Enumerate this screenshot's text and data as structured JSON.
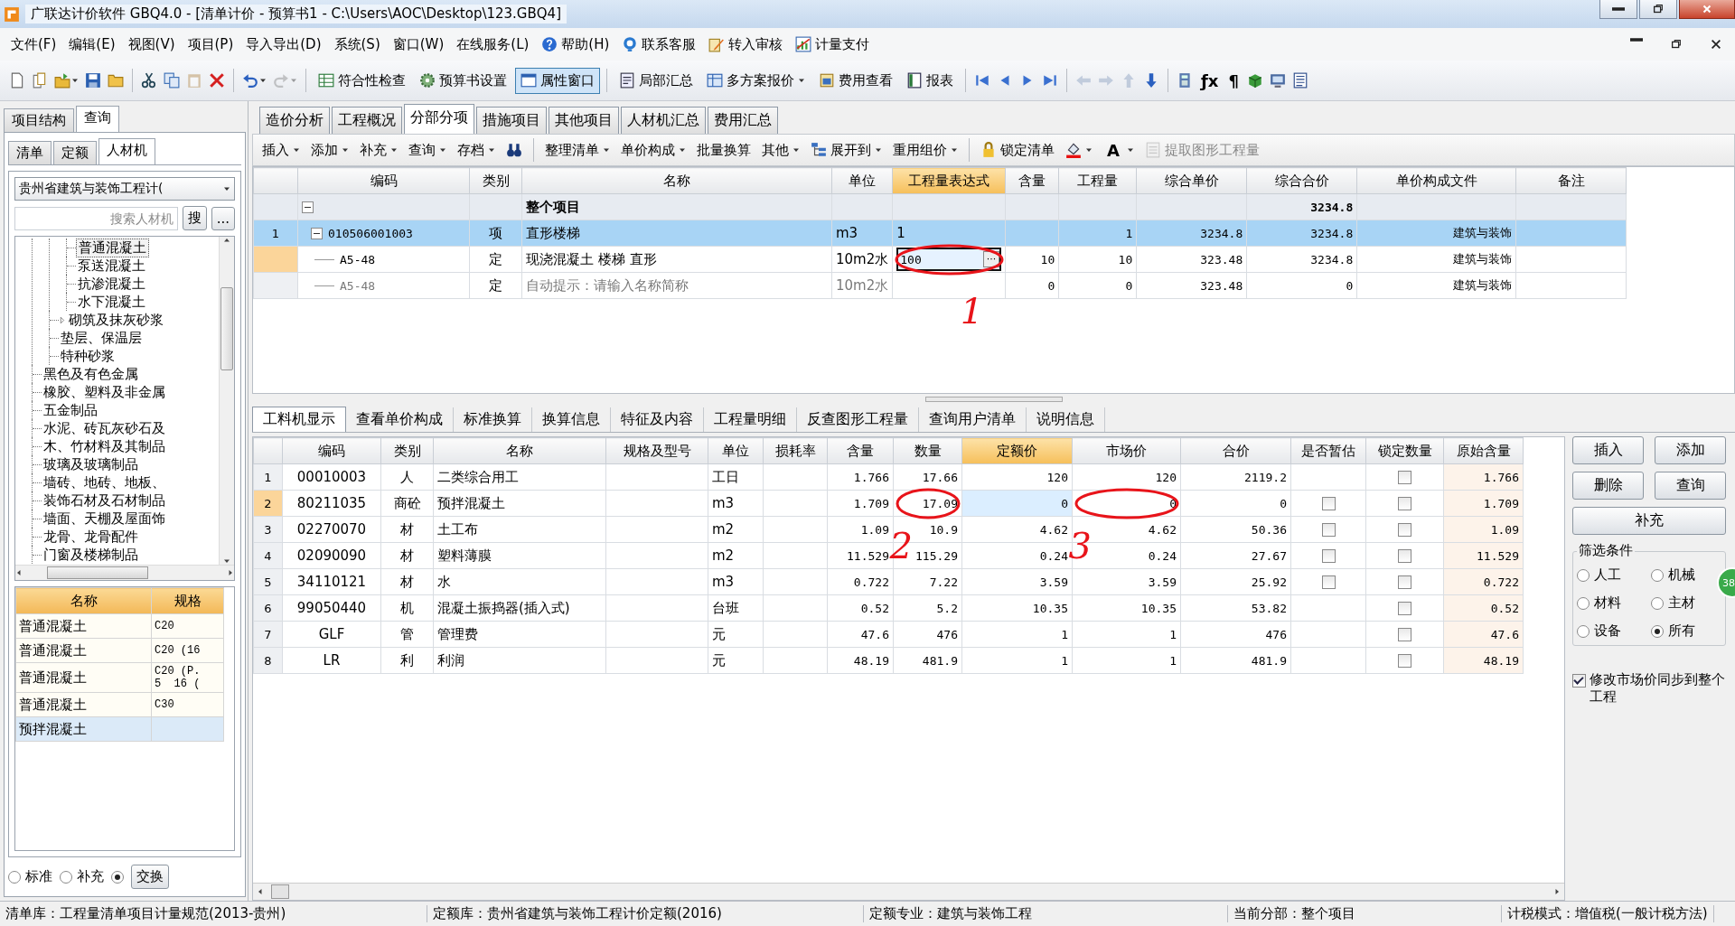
{
  "window": {
    "title": "广联达计价软件 GBQ4.0 - [清单计价 - 预算书1 - C:\\Users\\AOC\\Desktop\\123.GBQ4]"
  },
  "menu": [
    {
      "label": "文件(F)"
    },
    {
      "label": "编辑(E)"
    },
    {
      "label": "视图(V)"
    },
    {
      "label": "项目(P)"
    },
    {
      "label": "导入导出(D)"
    },
    {
      "label": "系统(S)"
    },
    {
      "label": "窗口(W)"
    },
    {
      "label": "在线服务(L)"
    },
    {
      "label": "帮助(H)",
      "kind": "help"
    },
    {
      "label": "联系客服",
      "kind": "service"
    },
    {
      "label": "转入审核",
      "kind": "review"
    },
    {
      "label": "计量支付",
      "kind": "payment"
    }
  ],
  "toolbar": [
    {
      "kind": "icon",
      "disabled": false
    },
    {
      "kind": "icon",
      "disabled": false
    },
    {
      "kind": "icon",
      "disabled": false,
      "dropdown": true
    },
    {
      "kind": "icon",
      "disabled": false
    },
    {
      "kind": "icon",
      "disabled": false
    },
    {
      "kind": "separator"
    },
    {
      "kind": "icon",
      "disabled": false
    },
    {
      "kind": "icon",
      "disabled": false
    },
    {
      "kind": "icon",
      "disabled": true
    },
    {
      "kind": "icon",
      "disabled": false
    },
    {
      "kind": "separator"
    },
    {
      "kind": "icon",
      "disabled": false,
      "dropdown": true
    },
    {
      "kind": "icon",
      "disabled": true,
      "dropdown": true
    },
    {
      "kind": "separator"
    },
    {
      "kind": "button",
      "label": "符合性检查",
      "selected": false
    },
    {
      "kind": "button",
      "label": "预算书设置",
      "selected": false
    },
    {
      "kind": "button",
      "label": "属性窗口",
      "selected": true
    },
    {
      "kind": "separator"
    },
    {
      "kind": "button",
      "label": "局部汇总",
      "selected": false
    },
    {
      "kind": "button",
      "label": "多方案报价",
      "selected": false,
      "dropdown": true
    },
    {
      "kind": "button",
      "label": "费用查看",
      "selected": false
    },
    {
      "kind": "button",
      "label": "报表",
      "selected": false
    },
    {
      "kind": "separator"
    },
    {
      "kind": "icon",
      "disabled": false
    },
    {
      "kind": "icon",
      "disabled": false
    },
    {
      "kind": "icon",
      "disabled": false
    },
    {
      "kind": "icon",
      "disabled": false
    },
    {
      "kind": "separator"
    },
    {
      "kind": "icon",
      "disabled": true
    },
    {
      "kind": "icon",
      "disabled": true
    },
    {
      "kind": "icon",
      "disabled": true
    },
    {
      "kind": "icon",
      "disabled": false
    },
    {
      "kind": "separator"
    },
    {
      "kind": "icon",
      "disabled": false
    },
    {
      "kind": "glyph",
      "label": "ƒx"
    },
    {
      "kind": "glyph",
      "label": "¶"
    },
    {
      "kind": "icon",
      "disabled": false
    },
    {
      "kind": "icon",
      "disabled": false
    },
    {
      "kind": "icon",
      "disabled": false
    }
  ],
  "sidebar": {
    "tabs": [
      {
        "label": "项目结构",
        "selected": false
      },
      {
        "label": "查询",
        "selected": true
      }
    ],
    "subtabs": [
      {
        "label": "清单",
        "selected": false
      },
      {
        "label": "定额",
        "selected": false
      },
      {
        "label": "人材机",
        "selected": true
      }
    ],
    "library": {
      "value": "贵州省建筑与装饰工程计("
    },
    "search": {
      "placeholder": "搜索人材机",
      "button": "搜",
      "more": "..."
    },
    "tree": [
      {
        "children": [
          {
            "children": [
              {
                "label": "普通混凝土",
                "selected": true
              },
              {
                "label": "泵送混凝土",
                "selected": false
              },
              {
                "label": "抗渗混凝土",
                "selected": false
              },
              {
                "label": "水下混凝土",
                "selected": false
              }
            ]
          },
          {
            "label": "砌筑及抹灰砂浆",
            "selected": false,
            "expanded": false
          },
          {
            "label": "垫层、保温层",
            "selected": false
          },
          {
            "label": "特种砂浆",
            "selected": false
          }
        ]
      },
      {
        "label": "黑色及有色金属",
        "selected": false
      },
      {
        "label": "橡胶、塑料及非金属",
        "selected": false
      },
      {
        "label": "五金制品",
        "selected": false
      },
      {
        "label": "水泥、砖瓦灰砂石及",
        "selected": false
      },
      {
        "label": "木、竹材料及其制品",
        "selected": false
      },
      {
        "label": "玻璃及玻璃制品",
        "selected": false
      },
      {
        "label": "墙砖、地砖、地板、",
        "selected": false
      },
      {
        "label": "装饰石材及石材制品",
        "selected": false
      },
      {
        "label": "墙面、天棚及屋面饰",
        "selected": false
      },
      {
        "label": "龙骨、龙骨配件",
        "selected": false
      },
      {
        "label": "门窗及楼梯制品",
        "selected": false
      }
    ],
    "materials": {
      "columns": [
        "名称",
        "规格"
      ],
      "rows": [
        {
          "name": "普通混凝土",
          "spec": "C20",
          "selected": false
        },
        {
          "name": "普通混凝土",
          "spec": "C20 (16",
          "selected": false
        },
        {
          "name": "普通混凝土",
          "spec": "C20 (P.\n5  16 (",
          "selected": false
        },
        {
          "name": "普通混凝土",
          "spec": "C30",
          "selected": false
        },
        {
          "name": "预拌混凝土",
          "selected": true
        }
      ]
    },
    "filters": [
      {
        "label": "标准",
        "selected": false
      },
      {
        "label": "补充",
        "selected": false
      },
      {
        "selected": true
      }
    ],
    "swap_button": "交换"
  },
  "tabs": [
    {
      "label": "造价分析",
      "selected": false
    },
    {
      "label": "工程概况",
      "selected": false
    },
    {
      "label": "分部分项",
      "selected": true
    },
    {
      "label": "措施项目",
      "selected": false
    },
    {
      "label": "其他项目",
      "selected": false
    },
    {
      "label": "人材机汇总",
      "selected": false
    },
    {
      "label": "费用汇总",
      "selected": false
    }
  ],
  "actions": [
    {
      "label": "插入",
      "dropdown": true
    },
    {
      "label": "添加",
      "dropdown": true
    },
    {
      "label": "补充",
      "dropdown": true
    },
    {
      "label": "查询",
      "dropdown": true
    },
    {
      "label": "存档",
      "dropdown": true
    },
    {
      "kind": "binoculars"
    },
    {
      "kind": "separator"
    },
    {
      "label": "整理清单",
      "dropdown": true
    },
    {
      "label": "单价构成",
      "dropdown": true
    },
    {
      "label": "批量换算"
    },
    {
      "label": "其他",
      "dropdown": true
    },
    {
      "label": "展开到",
      "dropdown": true,
      "kind": "tree"
    },
    {
      "label": "重用组价",
      "dropdown": true
    },
    {
      "kind": "separator"
    },
    {
      "label": "锁定清单",
      "kind": "lock"
    },
    {
      "kind": "fill",
      "dropdown": true
    },
    {
      "kind": "font",
      "glyph": "A",
      "dropdown": true
    },
    {
      "label": "提取图形工程量",
      "kind": "extract",
      "disabled": true
    }
  ],
  "upper_table": {
    "columns": [
      {
        "kind": "rownum"
      },
      {
        "label": "编码",
        "kind": "text"
      },
      {
        "label": "类别",
        "kind": "center"
      },
      {
        "label": "名称",
        "kind": "text"
      },
      {
        "label": "单位",
        "kind": "text"
      },
      {
        "label": "工程量表达式",
        "kind": "text",
        "highlighted": true
      },
      {
        "label": "含量",
        "kind": "number"
      },
      {
        "label": "工程量",
        "kind": "number"
      },
      {
        "label": "综合单价",
        "kind": "number"
      },
      {
        "label": "综合合价",
        "kind": "number"
      },
      {
        "label": "单价构成文件",
        "kind": "number"
      },
      {
        "label": "备注",
        "kind": "text"
      }
    ],
    "rows": [
      {
        "kind": "group",
        "expanded": true,
        "selected": false,
        "current": false,
        "cells": [
          null,
          null,
          null,
          "整个项目",
          null,
          null,
          null,
          null,
          null,
          "3234.8",
          null,
          null
        ]
      },
      {
        "kind": "item",
        "expanded": true,
        "selected": true,
        "current": false,
        "cells": [
          "1",
          "010506001003",
          "项",
          "直形楼梯",
          "m3",
          "1",
          null,
          "1",
          "3234.8",
          "3234.8",
          "建筑与装饰",
          null
        ]
      },
      {
        "kind": "sub",
        "selected": false,
        "current": true,
        "editing": true,
        "edit_button": "···",
        "cells": [
          null,
          "A5-48",
          "定",
          "现浇混凝土  楼梯  直形",
          "10m2水",
          "100",
          "10",
          "10",
          "323.48",
          "3234.8",
          "建筑与装饰",
          null
        ]
      },
      {
        "kind": "hint",
        "selected": false,
        "current": false,
        "cells": [
          null,
          "A5-48",
          "定",
          "自动提示：请输入名称简称",
          "10m2水",
          null,
          "0",
          "0",
          "323.48",
          "0",
          "建筑与装饰",
          null
        ]
      }
    ]
  },
  "detail_tabs": [
    {
      "label": "工料机显示",
      "selected": true
    },
    {
      "label": "查看单价构成",
      "selected": false
    },
    {
      "label": "标准换算",
      "selected": false
    },
    {
      "label": "换算信息",
      "selected": false
    },
    {
      "label": "特征及内容",
      "selected": false
    },
    {
      "label": "工程量明细",
      "selected": false
    },
    {
      "label": "反查图形工程量",
      "selected": false
    },
    {
      "label": "查询用户清单",
      "selected": false
    },
    {
      "label": "说明信息",
      "selected": false
    }
  ],
  "lower_table": {
    "columns": [
      {
        "kind": "rownum"
      },
      {
        "label": "编码",
        "kind": "center"
      },
      {
        "label": "类别",
        "kind": "center"
      },
      {
        "label": "名称",
        "kind": "text"
      },
      {
        "label": "规格及型号",
        "kind": "text"
      },
      {
        "label": "单位",
        "kind": "text"
      },
      {
        "label": "损耗率",
        "kind": "number"
      },
      {
        "label": "含量",
        "kind": "number"
      },
      {
        "label": "数量",
        "kind": "number"
      },
      {
        "label": "定额价",
        "kind": "number",
        "highlighted": true
      },
      {
        "label": "市场价",
        "kind": "number"
      },
      {
        "label": "合价",
        "kind": "number"
      },
      {
        "label": "是否暂估",
        "kind": "check"
      },
      {
        "label": "锁定数量",
        "kind": "check"
      },
      {
        "label": "原始含量",
        "kind": "shaded"
      }
    ],
    "rows": [
      {
        "current": false,
        "cells": [
          "1",
          "00010003",
          "人",
          "二类综合用工",
          null,
          "工日",
          null,
          "1.766",
          "17.66",
          "120",
          "120",
          "2119.2",
          null,
          {
            "checked": false
          },
          "1.766"
        ]
      },
      {
        "current": true,
        "editing": true,
        "cells": [
          "2",
          "80211035",
          "商砼",
          "预拌混凝土",
          null,
          "m3",
          null,
          "1.709",
          "17.09",
          "0",
          "0",
          "0",
          {
            "checked": false
          },
          {
            "checked": false
          },
          "1.709"
        ]
      },
      {
        "current": false,
        "cells": [
          "3",
          "02270070",
          "材",
          "土工布",
          null,
          "m2",
          null,
          "1.09",
          "10.9",
          "4.62",
          "4.62",
          "50.36",
          {
            "checked": false
          },
          {
            "checked": false
          },
          "1.09"
        ]
      },
      {
        "current": false,
        "cells": [
          "4",
          "02090090",
          "材",
          "塑料薄膜",
          null,
          "m2",
          null,
          "11.529",
          "115.29",
          "0.24",
          "0.24",
          "27.67",
          {
            "checked": false
          },
          {
            "checked": false
          },
          "11.529"
        ]
      },
      {
        "current": false,
        "cells": [
          "5",
          "34110121",
          "材",
          "水",
          null,
          "m3",
          null,
          "0.722",
          "7.22",
          "3.59",
          "3.59",
          "25.92",
          {
            "checked": false
          },
          {
            "checked": false
          },
          "0.722"
        ]
      },
      {
        "current": false,
        "cells": [
          "6",
          "99050440",
          "机",
          "混凝土振捣器(插入式)",
          null,
          "台班",
          null,
          "0.52",
          "5.2",
          "10.35",
          "10.35",
          "53.82",
          null,
          {
            "checked": false
          },
          "0.52"
        ]
      },
      {
        "current": false,
        "cells": [
          "7",
          "GLF",
          "管",
          "管理费",
          null,
          "元",
          null,
          "47.6",
          "476",
          "1",
          "1",
          "476",
          null,
          {
            "checked": false
          },
          "47.6"
        ]
      },
      {
        "current": false,
        "cells": [
          "8",
          "LR",
          "利",
          "利润",
          null,
          "元",
          null,
          "48.19",
          "481.9",
          "1",
          "1",
          "481.9",
          null,
          {
            "checked": false
          },
          "48.19"
        ]
      }
    ]
  },
  "side_buttons": [
    {
      "label": "插入",
      "wide": false
    },
    {
      "label": "添加",
      "wide": false
    },
    {
      "label": "删除",
      "wide": false
    },
    {
      "label": "查询",
      "wide": false
    },
    {
      "label": "补充",
      "wide": true
    }
  ],
  "filter_group": {
    "title": "筛选条件",
    "options": [
      {
        "label": "人工",
        "selected": false
      },
      {
        "label": "机械",
        "selected": false
      },
      {
        "label": "材料",
        "selected": false
      },
      {
        "label": "主材",
        "selected": false
      },
      {
        "label": "设备",
        "selected": false
      },
      {
        "label": "所有",
        "selected": true
      }
    ]
  },
  "sync_option": {
    "label": "修改市场价同步到整个工程",
    "checked": true
  },
  "floating_badge": "38",
  "annotations": [
    {
      "label": "1"
    },
    {
      "label": "2"
    },
    {
      "label": "3"
    }
  ],
  "status_bar": [
    {
      "text": "清单库：工程量清单项目计量规范(2013-贵州)"
    },
    {
      "text": "定额库：贵州省建筑与装饰工程计价定额(2016)"
    },
    {
      "text": "定额专业：建筑与装饰工程"
    },
    {
      "text": "当前分部：整个项目"
    },
    {
      "text": "计税模式：增值税(一般计税方法)"
    }
  ]
}
